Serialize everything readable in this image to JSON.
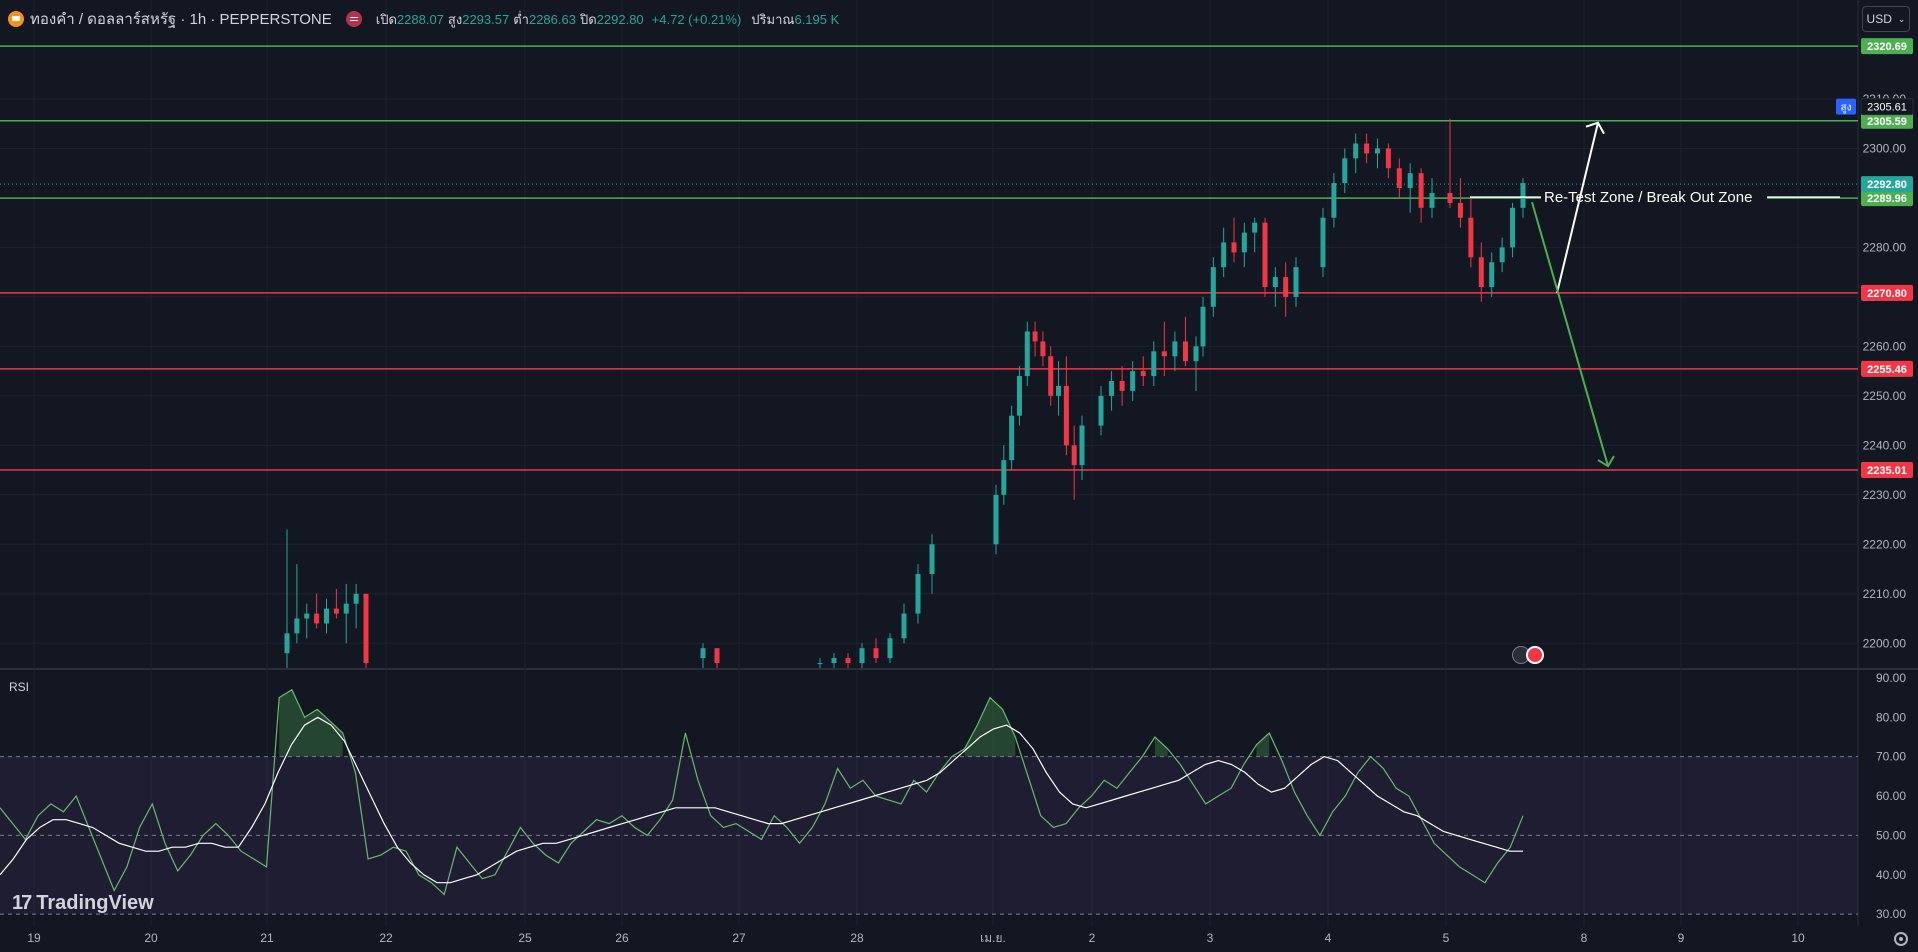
{
  "header": {
    "title": "ทองคำ / ดอลลาร์สหรัฐ · 1h · PEPPERSTONE",
    "open_label": "เปิด",
    "open_value": "2288.07",
    "high_label": "สูง",
    "high_value": "2293.57",
    "low_label": "ต่ำ",
    "low_value": "2286.63",
    "close_label": "ปิด",
    "close_value": "2292.80",
    "change": "+4.72 (+0.21%)",
    "volume_label": "ปริมาณ",
    "volume_value": "6.195 K"
  },
  "currency_button": "USD",
  "rsi_label": "RSI",
  "logo_text": "TradingView",
  "colors": {
    "up": "#26a69a",
    "down": "#f23645",
    "green_level": "#4caf50",
    "red_level": "#f23645",
    "rsi_line": "#66bb6a",
    "rsi_ma": "#ffffff",
    "background": "#131722"
  },
  "chart_data": [
    {
      "type": "candlestick",
      "timeframe": "1h",
      "ylim": [
        2195,
        2330
      ],
      "y_ticks": [
        "2200.00",
        "2210.00",
        "2220.00",
        "2230.00",
        "2240.00",
        "2250.00",
        "2260.00",
        "2270.00",
        "2280.00",
        "2290.00",
        "2300.00",
        "2310.00"
      ],
      "x_ticks": [
        "19",
        "20",
        "21",
        "22",
        "25",
        "26",
        "27",
        "28",
        "เม.ย.",
        "2",
        "3",
        "4",
        "5",
        "8",
        "9",
        "10"
      ],
      "horizontal_levels": [
        {
          "price": 2320.69,
          "label": "2320.69",
          "color": "green"
        },
        {
          "price": 2305.59,
          "label": "2305.59",
          "color": "green"
        },
        {
          "price": 2289.96,
          "label": "2289.96",
          "color": "green"
        },
        {
          "price": 2270.8,
          "label": "2270.80",
          "color": "red"
        },
        {
          "price": 2255.46,
          "label": "2255.46",
          "color": "red"
        },
        {
          "price": 2235.01,
          "label": "2235.01",
          "color": "red"
        }
      ],
      "high_marker": {
        "label": "สูง",
        "price": 2305.61,
        "text": "2305.61"
      },
      "last_price": {
        "price": 2292.8,
        "text": "2292.80"
      },
      "annotation": "Re-Test Zone / Break Out Zone",
      "scenario_arrows": [
        {
          "direction": "up",
          "from": 2270.8,
          "to": 2305.6,
          "color": "white"
        },
        {
          "direction": "down",
          "from": 2289.96,
          "to": 2235.0,
          "color": "green"
        }
      ],
      "candles": [
        {
          "d": "21",
          "o": 2198,
          "h": 2223,
          "l": 2195,
          "c": 2202
        },
        {
          "d": "21",
          "o": 2202,
          "h": 2216,
          "l": 2200,
          "c": 2205
        },
        {
          "d": "21",
          "o": 2205,
          "h": 2208,
          "l": 2201,
          "c": 2206
        },
        {
          "d": "21",
          "o": 2206,
          "h": 2210,
          "l": 2203,
          "c": 2204
        },
        {
          "d": "21",
          "o": 2204,
          "h": 2209,
          "l": 2202,
          "c": 2207
        },
        {
          "d": "21",
          "o": 2207,
          "h": 2211,
          "l": 2205,
          "c": 2206
        },
        {
          "d": "21",
          "o": 2206,
          "h": 2212,
          "l": 2200,
          "c": 2208
        },
        {
          "d": "21",
          "o": 2208,
          "h": 2212,
          "l": 2203,
          "c": 2210
        },
        {
          "d": "21",
          "o": 2210,
          "h": 2209,
          "l": 2195,
          "c": 2196
        },
        {
          "d": "26",
          "o": 2197,
          "h": 2200,
          "l": 2195,
          "c": 2199
        },
        {
          "d": "26",
          "o": 2199,
          "h": 2199,
          "l": 2195,
          "c": 2196
        },
        {
          "d": "28",
          "o": 2196,
          "h": 2197,
          "l": 2195,
          "c": 2196
        },
        {
          "d": "28",
          "o": 2196,
          "h": 2198,
          "l": 2195,
          "c": 2197
        },
        {
          "d": "28",
          "o": 2197,
          "h": 2198,
          "l": 2195,
          "c": 2196
        },
        {
          "d": "28",
          "o": 2196,
          "h": 2200,
          "l": 2195,
          "c": 2199
        },
        {
          "d": "28",
          "o": 2199,
          "h": 2201,
          "l": 2196,
          "c": 2197
        },
        {
          "d": "28",
          "o": 2197,
          "h": 2202,
          "l": 2196,
          "c": 2201
        },
        {
          "d": "28",
          "o": 2201,
          "h": 2208,
          "l": 2200,
          "c": 2206
        },
        {
          "d": "28",
          "o": 2206,
          "h": 2216,
          "l": 2204,
          "c": 2214
        },
        {
          "d": "28",
          "o": 2214,
          "h": 2222,
          "l": 2210,
          "c": 2220
        },
        {
          "d": "1",
          "o": 2220,
          "h": 2232,
          "l": 2218,
          "c": 2230
        },
        {
          "d": "1",
          "o": 2230,
          "h": 2240,
          "l": 2228,
          "c": 2237
        },
        {
          "d": "1",
          "o": 2237,
          "h": 2248,
          "l": 2235,
          "c": 2246
        },
        {
          "d": "1",
          "o": 2246,
          "h": 2256,
          "l": 2244,
          "c": 2254
        },
        {
          "d": "1",
          "o": 2254,
          "h": 2265,
          "l": 2252,
          "c": 2263
        },
        {
          "d": "1",
          "o": 2263,
          "h": 2265,
          "l": 2258,
          "c": 2261
        },
        {
          "d": "1",
          "o": 2261,
          "h": 2263,
          "l": 2256,
          "c": 2258
        },
        {
          "d": "1",
          "o": 2258,
          "h": 2260,
          "l": 2248,
          "c": 2250
        },
        {
          "d": "1",
          "o": 2250,
          "h": 2257,
          "l": 2246,
          "c": 2252
        },
        {
          "d": "1",
          "o": 2252,
          "h": 2258,
          "l": 2238,
          "c": 2240
        },
        {
          "d": "1",
          "o": 2240,
          "h": 2244,
          "l": 2229,
          "c": 2236
        },
        {
          "d": "1",
          "o": 2236,
          "h": 2246,
          "l": 2233,
          "c": 2244
        },
        {
          "d": "2",
          "o": 2244,
          "h": 2252,
          "l": 2242,
          "c": 2250
        },
        {
          "d": "2",
          "o": 2250,
          "h": 2255,
          "l": 2247,
          "c": 2253
        },
        {
          "d": "2",
          "o": 2253,
          "h": 2256,
          "l": 2248,
          "c": 2251
        },
        {
          "d": "2",
          "o": 2251,
          "h": 2257,
          "l": 2249,
          "c": 2255
        },
        {
          "d": "2",
          "o": 2255,
          "h": 2258,
          "l": 2252,
          "c": 2254
        },
        {
          "d": "2",
          "o": 2254,
          "h": 2261,
          "l": 2252,
          "c": 2259
        },
        {
          "d": "2",
          "o": 2259,
          "h": 2265,
          "l": 2254,
          "c": 2258
        },
        {
          "d": "2",
          "o": 2258,
          "h": 2263,
          "l": 2255,
          "c": 2261
        },
        {
          "d": "2",
          "o": 2261,
          "h": 2266,
          "l": 2256,
          "c": 2257
        },
        {
          "d": "2",
          "o": 2257,
          "h": 2262,
          "l": 2251,
          "c": 2260
        },
        {
          "d": "3",
          "o": 2260,
          "h": 2270,
          "l": 2258,
          "c": 2268
        },
        {
          "d": "3",
          "o": 2268,
          "h": 2278,
          "l": 2266,
          "c": 2276
        },
        {
          "d": "3",
          "o": 2276,
          "h": 2284,
          "l": 2274,
          "c": 2281
        },
        {
          "d": "3",
          "o": 2281,
          "h": 2286,
          "l": 2277,
          "c": 2279
        },
        {
          "d": "3",
          "o": 2279,
          "h": 2285,
          "l": 2276,
          "c": 2283
        },
        {
          "d": "3",
          "o": 2283,
          "h": 2286,
          "l": 2279,
          "c": 2285
        },
        {
          "d": "3",
          "o": 2285,
          "h": 2286,
          "l": 2270,
          "c": 2272
        },
        {
          "d": "3",
          "o": 2272,
          "h": 2276,
          "l": 2268,
          "c": 2274
        },
        {
          "d": "3",
          "o": 2274,
          "h": 2277,
          "l": 2266,
          "c": 2270
        },
        {
          "d": "3",
          "o": 2270,
          "h": 2278,
          "l": 2268,
          "c": 2276
        },
        {
          "d": "4",
          "o": 2276,
          "h": 2288,
          "l": 2274,
          "c": 2286
        },
        {
          "d": "4",
          "o": 2286,
          "h": 2295,
          "l": 2284,
          "c": 2293
        },
        {
          "d": "4",
          "o": 2293,
          "h": 2300,
          "l": 2291,
          "c": 2298
        },
        {
          "d": "4",
          "o": 2298,
          "h": 2303,
          "l": 2295,
          "c": 2301
        },
        {
          "d": "4",
          "o": 2301,
          "h": 2303,
          "l": 2297,
          "c": 2299
        },
        {
          "d": "4",
          "o": 2299,
          "h": 2302,
          "l": 2296,
          "c": 2300
        },
        {
          "d": "4",
          "o": 2300,
          "h": 2301,
          "l": 2294,
          "c": 2296
        },
        {
          "d": "4",
          "o": 2296,
          "h": 2298,
          "l": 2290,
          "c": 2292
        },
        {
          "d": "4",
          "o": 2292,
          "h": 2297,
          "l": 2287,
          "c": 2295
        },
        {
          "d": "4",
          "o": 2295,
          "h": 2296,
          "l": 2285,
          "c": 2288
        },
        {
          "d": "4",
          "o": 2288,
          "h": 2294,
          "l": 2286,
          "c": 2291
        },
        {
          "d": "5",
          "o": 2291,
          "h": 2306,
          "l": 2288,
          "c": 2289
        },
        {
          "d": "5",
          "o": 2289,
          "h": 2294,
          "l": 2284,
          "c": 2286
        },
        {
          "d": "5",
          "o": 2286,
          "h": 2290,
          "l": 2276,
          "c": 2278
        },
        {
          "d": "5",
          "o": 2278,
          "h": 2281,
          "l": 2269,
          "c": 2272
        },
        {
          "d": "5",
          "o": 2272,
          "h": 2279,
          "l": 2270,
          "c": 2277
        },
        {
          "d": "5",
          "o": 2277,
          "h": 2282,
          "l": 2275,
          "c": 2280
        },
        {
          "d": "5",
          "o": 2280,
          "h": 2289,
          "l": 2278,
          "c": 2288
        },
        {
          "d": "5",
          "o": 2288,
          "h": 2294,
          "l": 2286,
          "c": 2293
        }
      ]
    },
    {
      "type": "line",
      "name": "RSI",
      "ylim": [
        27,
        92
      ],
      "y_ticks": [
        "30.00",
        "40.00",
        "50.00",
        "60.00",
        "70.00",
        "80.00",
        "90.00"
      ],
      "bands": [
        30,
        50,
        70
      ],
      "rsi": [
        57,
        53,
        49,
        55,
        58,
        56,
        60,
        52,
        44,
        36,
        42,
        52,
        58,
        48,
        41,
        45,
        50,
        53,
        50,
        46,
        44,
        42,
        85,
        87,
        80,
        82,
        79,
        76,
        66,
        44,
        45,
        47,
        46,
        40,
        38,
        35,
        47,
        43,
        39,
        40,
        46,
        52,
        48,
        45,
        43,
        48,
        51,
        54,
        53,
        55,
        52,
        50,
        54,
        59,
        76,
        64,
        55,
        52,
        53,
        51,
        49,
        55,
        52,
        48,
        52,
        58,
        67,
        62,
        64,
        60,
        59,
        58,
        64,
        61,
        66,
        70,
        72,
        78,
        85,
        82,
        75,
        65,
        55,
        52,
        53,
        57,
        60,
        64,
        62,
        66,
        70,
        75,
        72,
        68,
        63,
        58,
        60,
        62,
        68,
        73,
        76,
        69,
        61,
        55,
        50,
        56,
        60,
        66,
        70,
        67,
        62,
        60,
        54,
        48,
        45,
        42,
        40,
        38,
        43,
        47,
        55
      ],
      "rsi_ma": [
        40,
        44,
        49,
        52,
        54,
        54,
        53,
        52,
        50,
        48,
        47,
        46,
        46,
        47,
        47,
        48,
        48,
        47,
        47,
        52,
        58,
        66,
        73,
        78,
        80,
        78,
        74,
        67,
        60,
        53,
        47,
        43,
        40,
        38,
        38,
        39,
        40,
        42,
        44,
        46,
        47,
        48,
        48,
        49,
        50,
        51,
        52,
        53,
        54,
        55,
        56,
        57,
        57,
        57,
        57,
        56,
        55,
        54,
        53,
        53,
        54,
        55,
        56,
        57,
        58,
        59,
        60,
        61,
        62,
        63,
        64,
        66,
        69,
        72,
        75,
        77,
        78,
        76,
        72,
        66,
        61,
        58,
        57,
        58,
        59,
        60,
        61,
        62,
        63,
        64,
        66,
        68,
        69,
        68,
        66,
        63,
        61,
        62,
        65,
        68,
        70,
        69,
        66,
        63,
        60,
        58,
        56,
        55,
        53,
        51,
        50,
        49,
        48,
        47,
        46,
        46
      ]
    }
  ]
}
